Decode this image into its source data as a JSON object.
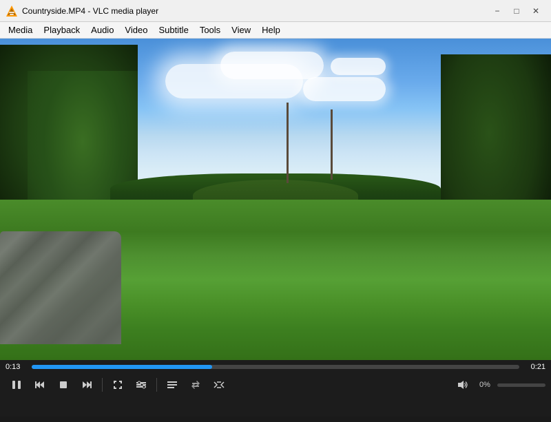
{
  "window": {
    "title": "Countryside.MP4 - VLC media player",
    "icon": "vlc"
  },
  "menu": {
    "items": [
      "Media",
      "Playback",
      "Audio",
      "Video",
      "Subtitle",
      "Tools",
      "View",
      "Help"
    ]
  },
  "controls": {
    "time_current": "0:13",
    "time_total": "0:21",
    "progress_pct": 37,
    "volume_pct": "0%",
    "volume_fill": 0,
    "play_label": "⏸",
    "skip_back_label": "⏮",
    "stop_label": "⏹",
    "skip_fwd_label": "⏭",
    "fullscreen_label": "⛶",
    "extended_label": "|||",
    "playlist_label": "☰",
    "loop_label": "↺",
    "random_label": "⤮",
    "volume_icon": "🔈"
  }
}
